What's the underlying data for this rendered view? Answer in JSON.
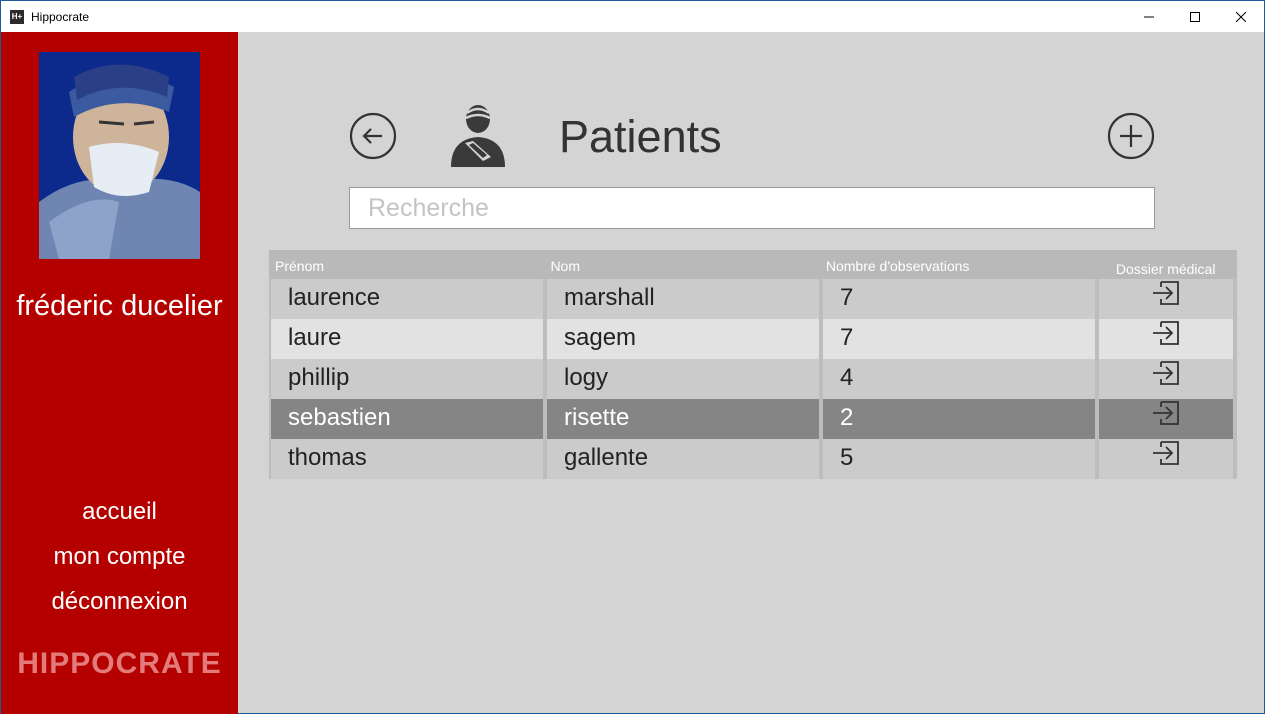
{
  "window": {
    "title": "Hippocrate",
    "icon_text": "H+"
  },
  "sidebar": {
    "user_name": "fréderic ducelier",
    "nav": [
      "accueil",
      "mon compte",
      "déconnexion"
    ],
    "logo": "HIPPOCRATE"
  },
  "main": {
    "title": "Patients",
    "search": {
      "placeholder": "Recherche",
      "value": ""
    }
  },
  "table": {
    "headers": [
      "Prénom",
      "Nom",
      "Nombre d'observations",
      "Dossier médical"
    ],
    "rows": [
      {
        "prenom": "laurence",
        "nom": "marshall",
        "observations": "7"
      },
      {
        "prenom": "laure",
        "nom": "sagem",
        "observations": "7"
      },
      {
        "prenom": "phillip",
        "nom": "logy",
        "observations": "4"
      },
      {
        "prenom": "sebastien",
        "nom": "risette",
        "observations": "2"
      },
      {
        "prenom": "thomas",
        "nom": "gallente",
        "observations": "5"
      }
    ],
    "selected_index": 3,
    "open_icon": "open-file-icon"
  },
  "colors": {
    "sidebar": "#b50000",
    "background": "#d4d4d4",
    "header_row": "#b9b9b9",
    "selected_row": "#858585",
    "logo": "#e37b7b"
  }
}
